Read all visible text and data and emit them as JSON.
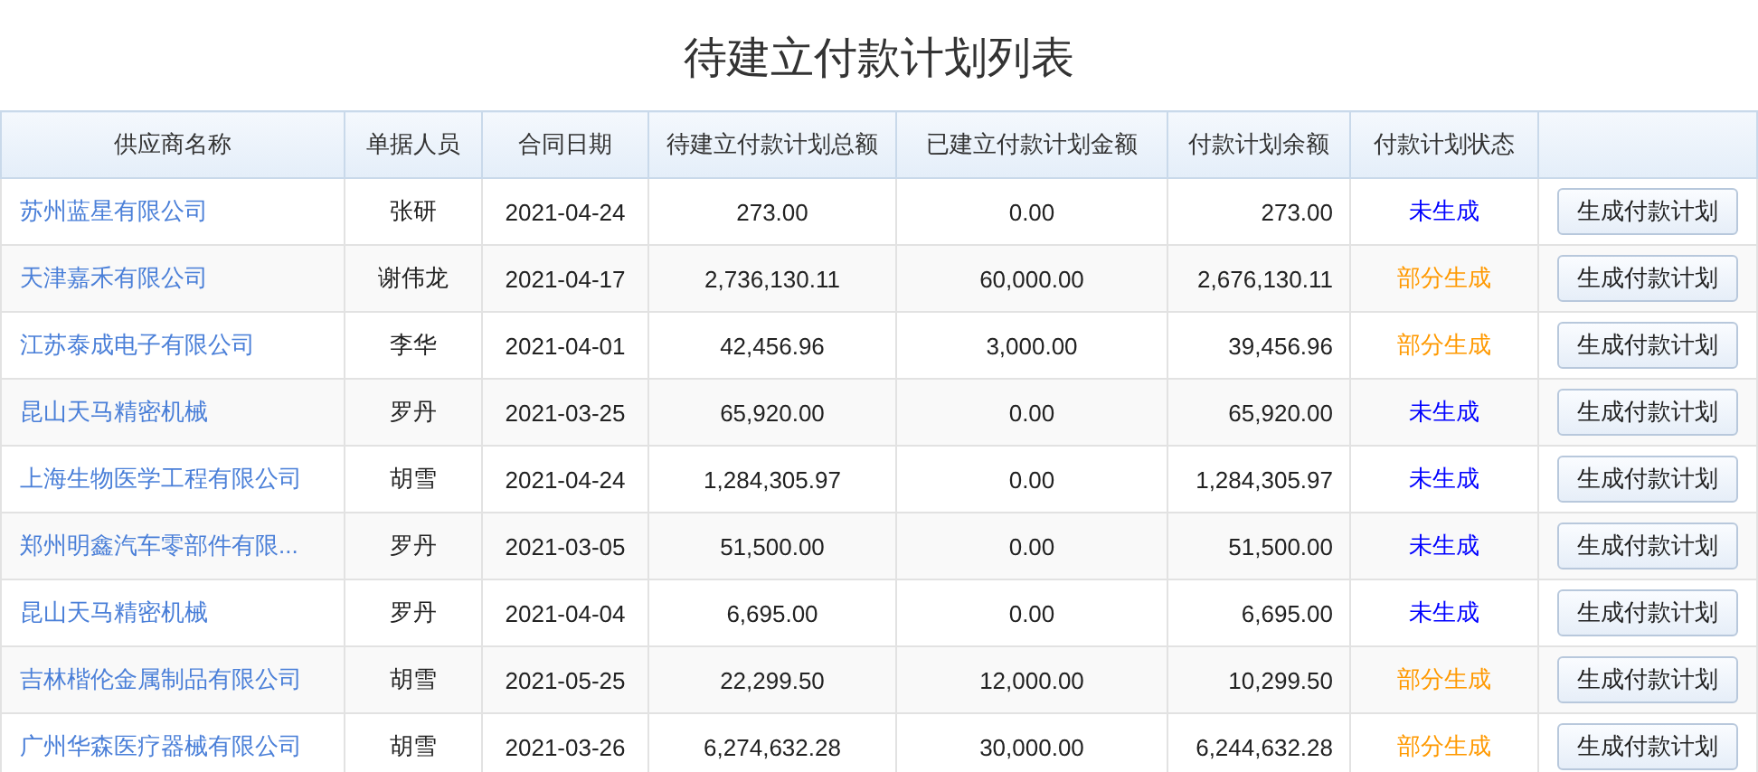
{
  "title": "待建立付款计划列表",
  "table": {
    "columns": [
      "供应商名称",
      "单据人员",
      "合同日期",
      "待建立付款计划总额",
      "已建立付款计划金额",
      "付款计划余额",
      "付款计划状态"
    ],
    "rows": [
      {
        "supplier": "苏州蓝星有限公司",
        "person": "张研",
        "date": "2021-04-24",
        "total": "273.00",
        "created": "0.00",
        "balance": "273.00",
        "status": "未生成",
        "color": "#0000ff",
        "action": "生成付款计划"
      },
      {
        "supplier": "天津嘉禾有限公司",
        "person": "谢伟龙",
        "date": "2021-04-17",
        "total": "2,736,130.11",
        "created": "60,000.00",
        "balance": "2,676,130.11",
        "status": "部分生成",
        "color": "#ff9900",
        "action": "生成付款计划"
      },
      {
        "supplier": "江苏泰成电子有限公司",
        "person": "李华",
        "date": "2021-04-01",
        "total": "42,456.96",
        "created": "3,000.00",
        "balance": "39,456.96",
        "status": "部分生成",
        "color": "#ff9900",
        "action": "生成付款计划"
      },
      {
        "supplier": "昆山天马精密机械",
        "person": "罗丹",
        "date": "2021-03-25",
        "total": "65,920.00",
        "created": "0.00",
        "balance": "65,920.00",
        "status": "未生成",
        "color": "#0000ff",
        "action": "生成付款计划"
      },
      {
        "supplier": "上海生物医学工程有限公司",
        "person": "胡雪",
        "date": "2021-04-24",
        "total": "1,284,305.97",
        "created": "0.00",
        "balance": "1,284,305.97",
        "status": "未生成",
        "color": "#0000ff",
        "action": "生成付款计划"
      },
      {
        "supplier": "郑州明鑫汽车零部件有限...",
        "person": "罗丹",
        "date": "2021-03-05",
        "total": "51,500.00",
        "created": "0.00",
        "balance": "51,500.00",
        "status": "未生成",
        "color": "#0000ff",
        "action": "生成付款计划"
      },
      {
        "supplier": "昆山天马精密机械",
        "person": "罗丹",
        "date": "2021-04-04",
        "total": "6,695.00",
        "created": "0.00",
        "balance": "6,695.00",
        "status": "未生成",
        "color": "#0000ff",
        "action": "生成付款计划"
      },
      {
        "supplier": "吉林楷伦金属制品有限公司",
        "person": "胡雪",
        "date": "2021-05-25",
        "total": "22,299.50",
        "created": "12,000.00",
        "balance": "10,299.50",
        "status": "部分生成",
        "color": "#ff9900",
        "action": "生成付款计划"
      },
      {
        "supplier": "广州华森医疗器械有限公司",
        "person": "胡雪",
        "date": "2021-03-26",
        "total": "6,274,632.28",
        "created": "30,000.00",
        "balance": "6,244,632.28",
        "status": "部分生成",
        "color": "#ff9900",
        "action": "生成付款计划"
      }
    ]
  }
}
